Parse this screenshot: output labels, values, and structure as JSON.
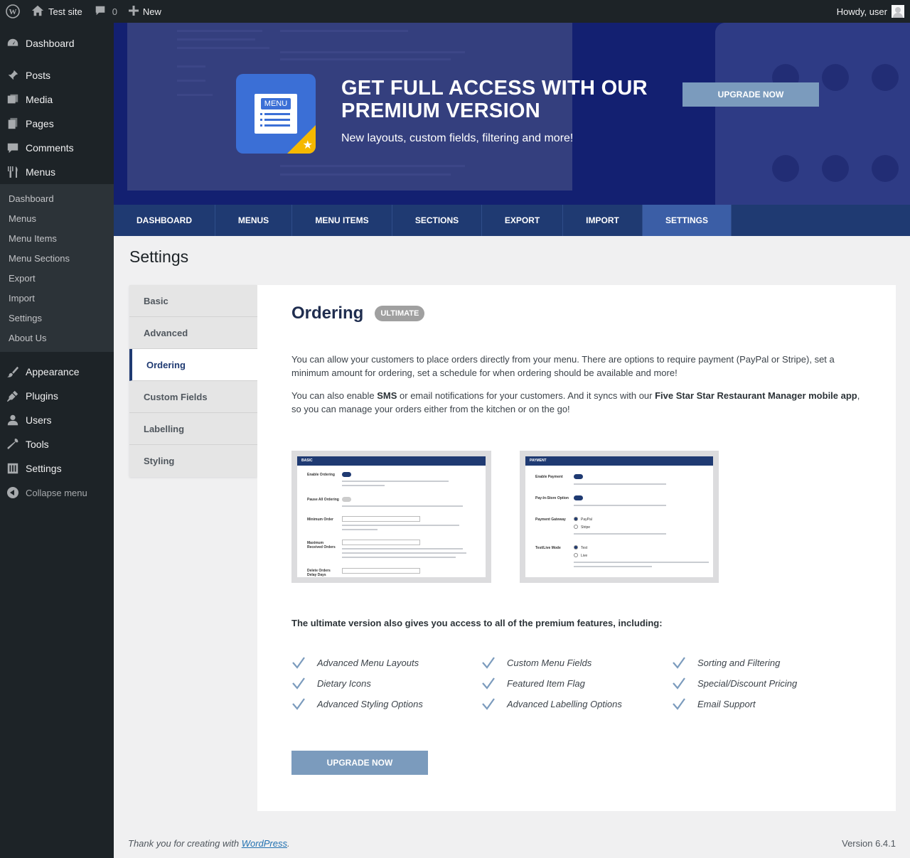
{
  "adminbar": {
    "site_name": "Test site",
    "comments_count": "0",
    "new_label": "New",
    "howdy": "Howdy, user"
  },
  "sidebar": {
    "items_top": [
      {
        "label": "Dashboard",
        "icon": "dashboard-icon"
      }
    ],
    "items_main": [
      {
        "label": "Posts",
        "icon": "pin-icon"
      },
      {
        "label": "Media",
        "icon": "media-icon"
      },
      {
        "label": "Pages",
        "icon": "pages-icon"
      },
      {
        "label": "Comments",
        "icon": "comment-icon"
      },
      {
        "label": "Menus",
        "icon": "fork-knife-icon"
      }
    ],
    "submenu": [
      "Dashboard",
      "Menus",
      "Menu Items",
      "Menu Sections",
      "Export",
      "Import",
      "Settings",
      "About Us"
    ],
    "items_bottom": [
      {
        "label": "Appearance",
        "icon": "brush-icon"
      },
      {
        "label": "Plugins",
        "icon": "plugin-icon"
      },
      {
        "label": "Users",
        "icon": "user-icon"
      },
      {
        "label": "Tools",
        "icon": "wrench-icon"
      },
      {
        "label": "Settings",
        "icon": "sliders-icon"
      }
    ],
    "collapse_label": "Collapse menu"
  },
  "banner": {
    "logo_text": "MENU",
    "headline": "GET FULL ACCESS WITH OUR PREMIUM VERSION",
    "subline": "New layouts, custom fields, filtering and more!",
    "upgrade_label": "UPGRADE NOW"
  },
  "navbar": {
    "tabs": [
      "DASHBOARD",
      "MENUS",
      "MENU ITEMS",
      "SECTIONS",
      "EXPORT",
      "IMPORT",
      "SETTINGS"
    ],
    "active": "SETTINGS"
  },
  "page": {
    "title": "Settings"
  },
  "settings_tabs": {
    "items": [
      "Basic",
      "Advanced",
      "Ordering",
      "Custom Fields",
      "Labelling",
      "Styling"
    ],
    "active": "Ordering"
  },
  "panel": {
    "heading": "Ordering",
    "badge": "ULTIMATE",
    "para1": "You can allow your customers to place orders directly from your menu. There are options to require payment (PayPal or Stripe), set a minimum amount for ordering, set a schedule for when ordering should be available and more!",
    "para2_a": "You can also enable ",
    "para2_sms": "SMS",
    "para2_b": " or email notifications for your customers. And it syncs with our ",
    "para2_app": "Five Star Star Restaurant Manager mobile app",
    "para2_c": ", so you can manage your orders either from the kitchen or on the go!",
    "shot1_title": "BASIC",
    "shot2_title": "PAYMENT",
    "shot1_labels": [
      "Enable Ordering",
      "Pause All Ordering",
      "Minimum Order",
      "Maximum Received Orders",
      "Delete Orders Delay Days"
    ],
    "shot2_labels": [
      "Enable Payment",
      "Pay-In-Store Option",
      "Payment Gateway",
      "Test/Live Mode"
    ],
    "shot2_options": [
      "PayPal",
      "Stripe",
      "Test",
      "Live"
    ],
    "features_intro": "The ultimate version also gives you access to all of the premium features, including:",
    "features": [
      [
        "Advanced Menu Layouts",
        "Custom Menu Fields",
        "Sorting and Filtering"
      ],
      [
        "Dietary Icons",
        "Featured Item Flag",
        "Special/Discount Pricing"
      ],
      [
        "Advanced Styling Options",
        "Advanced Labelling Options",
        "Email Support"
      ]
    ],
    "upgrade_label": "UPGRADE NOW"
  },
  "footer": {
    "thanks_a": "Thank you for creating with ",
    "thanks_link": "WordPress",
    "thanks_b": ".",
    "version": "Version 6.4.1"
  },
  "colors": {
    "sidebar_bg": "#1d2327",
    "navbar_bg": "#1f3a72",
    "navbar_active": "#3b5ea6",
    "upgrade_button": "#7b9bbd",
    "banner_bg": "#101e6e"
  }
}
